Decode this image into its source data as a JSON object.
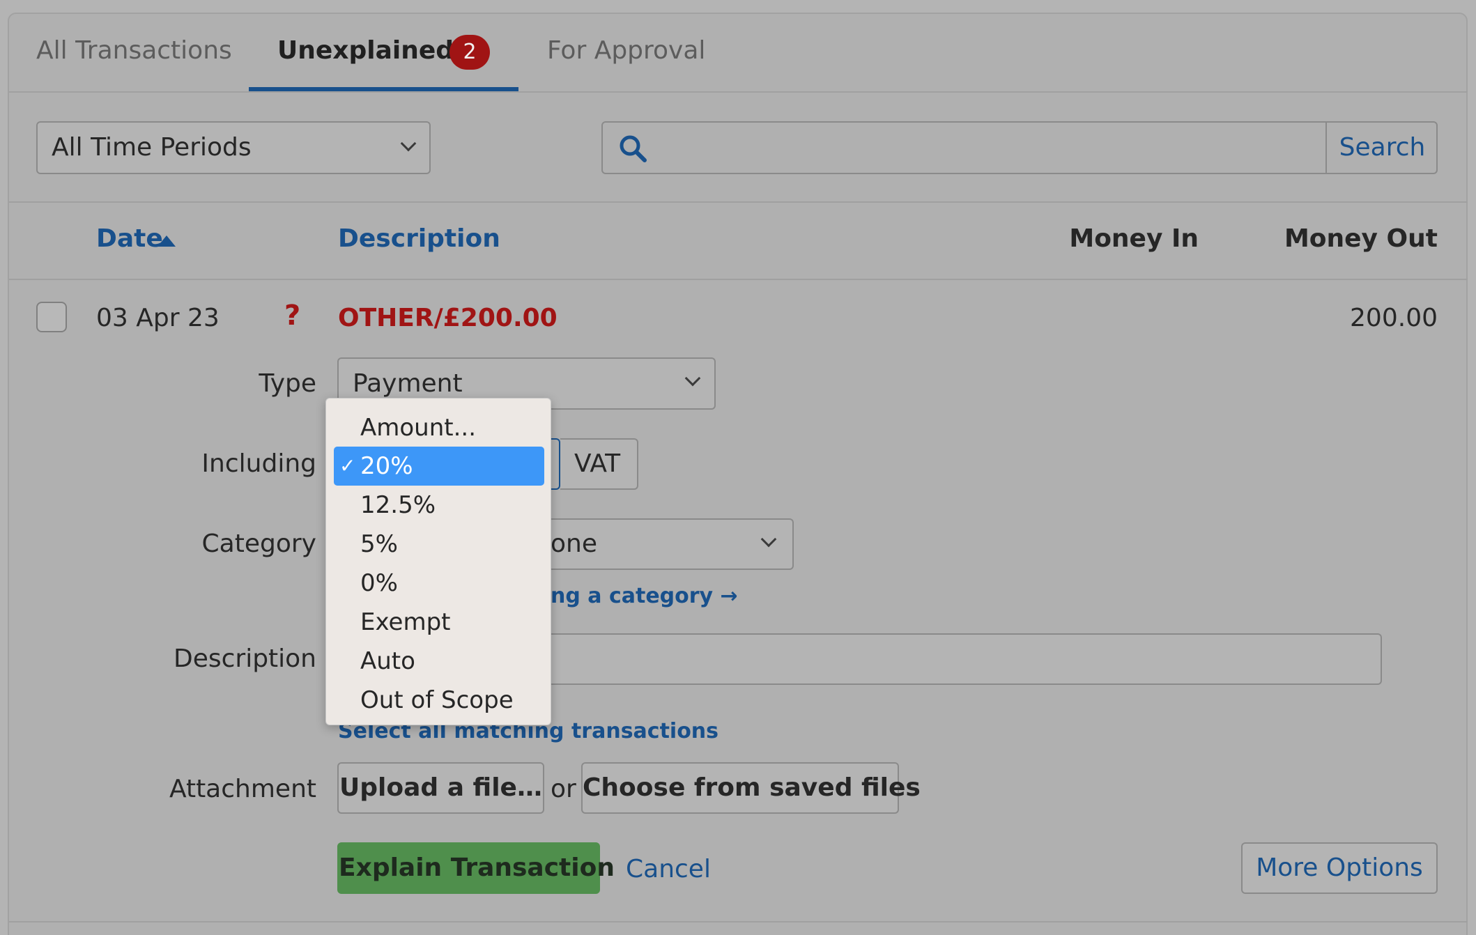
{
  "tabs": [
    {
      "label": "All Transactions"
    },
    {
      "label": "Unexplained",
      "badge": "2"
    },
    {
      "label": "For Approval"
    }
  ],
  "filters": {
    "time_period": "All Time Periods",
    "search_value": "",
    "search_button": "Search"
  },
  "table": {
    "headers": {
      "date": "Date",
      "description": "Description",
      "money_in": "Money In",
      "money_out": "Money Out"
    },
    "row": {
      "date": "03 Apr 23",
      "status_symbol": "?",
      "description": "OTHER/£200.00",
      "money_in": "",
      "money_out": "200.00"
    }
  },
  "form": {
    "type_label": "Type",
    "type_value": "Payment",
    "including_label": "Including",
    "vat_label": "VAT",
    "category_label": "Category",
    "category_value_visible": "one",
    "category_help": "ng a category →",
    "description_label": "Description",
    "description_value": "",
    "select_matching": "Select all matching transactions",
    "attachment_label": "Attachment",
    "upload_button": "Upload a file…",
    "or_text": "or",
    "choose_saved": "Choose from saved files",
    "explain_button": "Explain Transaction",
    "cancel_link": "Cancel",
    "more_options": "More Options"
  },
  "vat_dropdown": {
    "options": [
      "Amount...",
      "20%",
      "12.5%",
      "5%",
      "0%",
      "Exempt",
      "Auto",
      "Out of Scope"
    ],
    "selected": "20%",
    "check_glyph": "✓"
  },
  "colors": {
    "accent_blue": "#18508c",
    "badge_red": "#a01414",
    "explain_green": "#4f8f4c",
    "dropdown_highlight": "#3d97f8"
  }
}
